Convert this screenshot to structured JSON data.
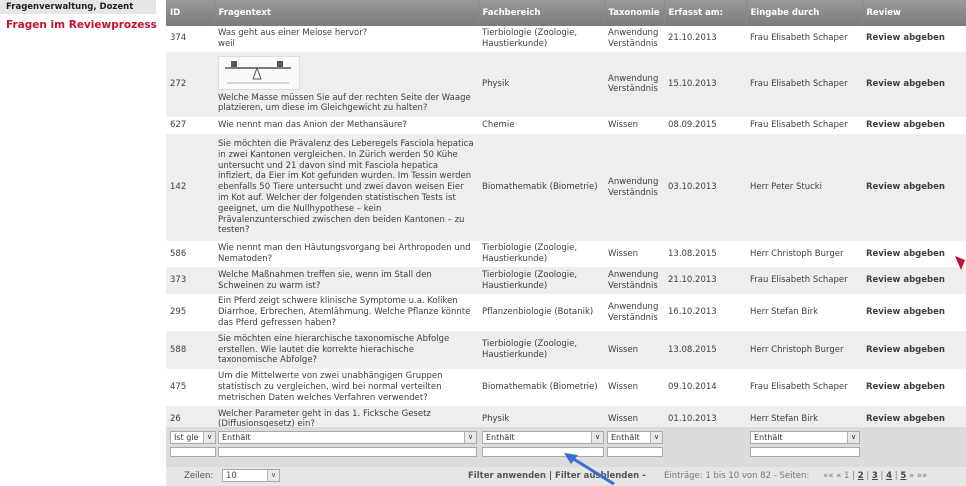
{
  "sidebar": {
    "header": "Fragenverwaltung, Dozent",
    "active_item": "Fragen im Reviewprozess"
  },
  "table": {
    "columns": [
      "ID",
      "Fragentext",
      "Fachbereich",
      "Taxonomie",
      "Erfasst am:",
      "Eingabe durch",
      "Review"
    ],
    "rows": [
      {
        "id": "374",
        "text": "Was geht aus einer Meiose hervor?\nweil",
        "fach": "Tierbiologie (Zoologie, Haustierkunde)",
        "tax": "Anwendung Verständnis",
        "date": "21.10.2013",
        "by": "Frau Elisabeth Schaper",
        "review": "Review abgeben"
      },
      {
        "id": "272",
        "text": "Welche Masse müssen Sie auf der rechten Seite der Waage platzieren, um diese im Gleichgewicht zu halten?",
        "fach": "Physik",
        "tax": "Anwendung Verständnis",
        "date": "15.10.2013",
        "by": "Frau Elisabeth Schaper",
        "review": "Review abgeben"
      },
      {
        "id": "627",
        "text": "Wie nennt man das Anion der Methansäure?",
        "fach": "Chemie",
        "tax": "Wissen",
        "date": "08.09.2015",
        "by": "Frau Elisabeth Schaper",
        "review": "Review abgeben"
      },
      {
        "id": "142",
        "text": "Sie möchten die Prävalenz des Leberegels Fasciola hepatica in zwei Kantonen vergleichen. In Zürich werden 50 Kühe untersucht und 21 davon sind mit Fasciola hepatica infiziert, da Eier im Kot gefunden wurden. Im Tessin werden ebenfalls 50 Tiere untersucht und zwei davon weisen Eier im Kot auf. Welcher der folgenden statistischen Tests ist geeignet, um die Nullhypothese – kein Prävalenzunterschied zwischen den beiden Kantonen – zu testen?",
        "fach": "Biomathematik (Biometrie)",
        "tax": "Anwendung Verständnis",
        "date": "03.10.2013",
        "by": "Herr Peter Stucki",
        "review": "Review abgeben"
      },
      {
        "id": "586",
        "text": " Wie nennt man den Häutungsvorgang bei Arthropoden und Nematoden?",
        "fach": "Tierbiologie (Zoologie, Haustierkunde)",
        "tax": "Wissen",
        "date": "13.08.2015",
        "by": "Herr Christoph Burger",
        "review": "Review abgeben"
      },
      {
        "id": "373",
        "text": "Welche Maßnahmen treffen sie, wenn im Stall den Schweinen zu warm ist?",
        "fach": "Tierbiologie (Zoologie, Haustierkunde)",
        "tax": "Anwendung Verständnis",
        "date": "21.10.2013",
        "by": "Frau Elisabeth Schaper",
        "review": "Review abgeben"
      },
      {
        "id": "295",
        "text": "Ein Pferd zeigt schwere klinische Symptome u.a. Koliken Diarrhoe, Erbrechen, Atemlähmung. Welche Pflanze könnte das Pferd gefressen haben?",
        "fach": "Pflanzenbiologie (Botanik)",
        "tax": "Anwendung Verständnis",
        "date": "16.10.2013",
        "by": "Herr Stefan Birk",
        "review": "Review abgeben"
      },
      {
        "id": "588",
        "text": " Sie möchten eine hierarchische taxonomische Abfolge erstellen. Wie lautet die korrekte hierachische taxonomische Abfolge?",
        "fach": "Tierbiologie (Zoologie, Haustierkunde)",
        "tax": "Wissen",
        "date": "13.08.2015",
        "by": "Herr Christoph Burger",
        "review": "Review abgeben"
      },
      {
        "id": "475",
        "text": "Um die Mittelwerte von zwei unabhängigen Gruppen statistisch zu vergleichen, wird bei normal verteilten metrischen Daten welches Verfahren verwendet?",
        "fach": "Biomathematik (Biometrie)",
        "tax": "Wissen",
        "date": "09.10.2014",
        "by": "Frau Elisabeth Schaper",
        "review": "Review abgeben"
      },
      {
        "id": "26",
        "text": "Welcher Parameter geht in das 1. Ficksche Gesetz (Diffusionsgesetz) ein?",
        "fach": "Physik",
        "tax": "Wissen",
        "date": "01.10.2013",
        "by": "Herr Stefan Birk",
        "review": "Review abgeben"
      }
    ]
  },
  "filters": {
    "id_filter": "Ist gle",
    "text_filter": "Enthält",
    "fach_filter": "Enthält",
    "tax_filter": "Enthält",
    "by_filter": "Enthält"
  },
  "footer": {
    "rows_label": "Zeilen:",
    "rows_value": "10",
    "apply_filter": "Filter anwenden",
    "separator": "|",
    "hide_filter": "Filter ausblenden",
    "dash": "-",
    "entries_info": "Einträge: 1 bis 10 von 82 - Seiten:",
    "pager_prev": "«« «",
    "pages": [
      "1",
      "2",
      "3",
      "4",
      "5"
    ],
    "pager_next": "» »»"
  },
  "colors": {
    "accent_red": "#c8102e",
    "header_gray": "#8a8a8a",
    "arrow_blue": "#3a6fd0"
  }
}
